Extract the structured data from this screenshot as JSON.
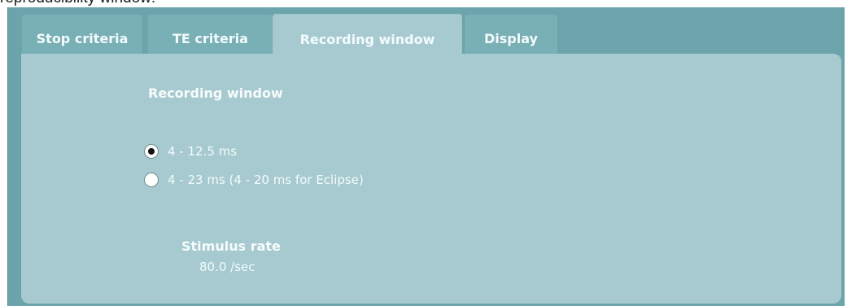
{
  "caption": "reproducibility window:",
  "tabs": [
    {
      "label": "Stop criteria",
      "active": false
    },
    {
      "label": "TE criteria",
      "active": false
    },
    {
      "label": "Recording window",
      "active": true
    },
    {
      "label": "Display",
      "active": false
    }
  ],
  "section": {
    "title": "Recording window",
    "options": [
      {
        "label": "4 - 12.5 ms",
        "selected": true
      },
      {
        "label": "4 - 23 ms (4 - 20 ms for Eclipse)",
        "selected": false
      }
    ]
  },
  "stimulus": {
    "title": "Stimulus rate",
    "value": "80.0 /sec"
  },
  "colors": {
    "frame": "#6ba5ab",
    "tab": "#78b0b6",
    "panel": "#a6cacf",
    "text": "#f4fbfc"
  }
}
